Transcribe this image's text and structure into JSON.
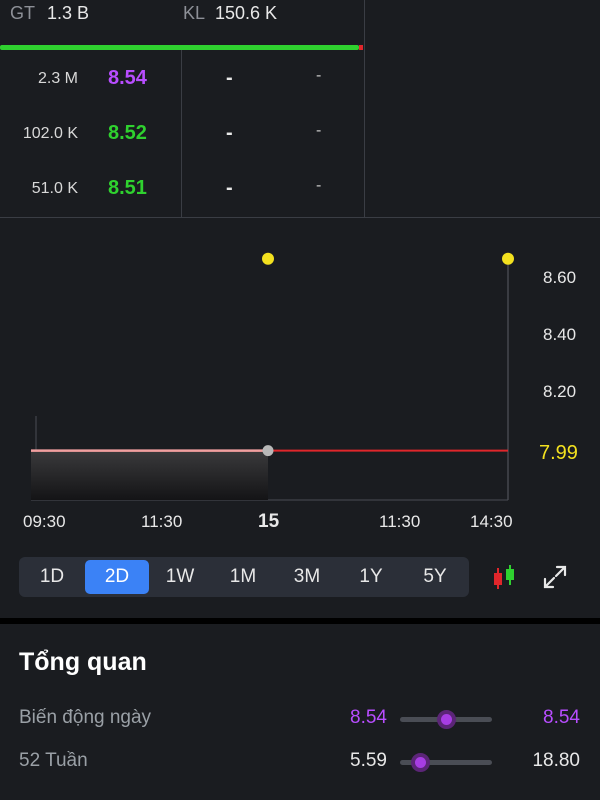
{
  "orderbook": {
    "stats": {
      "gt_label": "GT",
      "gt_value": "1.3 B",
      "kl_label": "KL",
      "kl_value": "150.6 K"
    },
    "bid_rows": [
      {
        "volume": "2.3 M",
        "price": "8.54",
        "price_color": "#b84dff",
        "col3": "-",
        "col4": "-"
      },
      {
        "volume": "102.0 K",
        "price": "8.52",
        "price_color": "#2fd12f",
        "col3": "-",
        "col4": "-"
      },
      {
        "volume": "51.0 K",
        "price": "8.51",
        "price_color": "#2fd12f",
        "col3": "-",
        "col4": "-"
      }
    ],
    "buy_sell_ratio": {
      "buy_fraction": 0.99,
      "buy_color": "#2fd12f",
      "sell_color": "#e0262b"
    }
  },
  "chart": {
    "y_ticks": [
      "8.60",
      "8.40",
      "8.20"
    ],
    "reference_price": "7.99",
    "x_ticks": [
      "09:30",
      "11:30",
      "15",
      "11:30",
      "14:30"
    ]
  },
  "chart_data": {
    "type": "line",
    "y_axis": {
      "min": 7.85,
      "max": 8.65,
      "ticks": [
        8.6,
        8.4,
        8.2
      ]
    },
    "reference_line": {
      "value": 7.99,
      "color": "#e0262b",
      "label_color": "#f3e11f"
    },
    "x_ticks": [
      "09:30",
      "11:30",
      "15",
      "11:30",
      "14:30"
    ],
    "series": [
      {
        "points": [
          {
            "x": "09:30",
            "y": 7.99
          },
          {
            "x": "15",
            "y": 7.99
          }
        ],
        "color": "#f0a0a0"
      }
    ],
    "markers": [
      {
        "x": "15",
        "y": 8.54,
        "color": "#f3e11f"
      },
      {
        "x": "14:30",
        "y": 8.54,
        "color": "#f3e11f"
      }
    ],
    "current_point": {
      "x": "15",
      "y": 7.99
    },
    "grid": false
  },
  "range_selector": {
    "tabs": [
      "1D",
      "2D",
      "1W",
      "1M",
      "3M",
      "1Y",
      "5Y"
    ],
    "active": "2D"
  },
  "tools": {
    "candlestick_icon": "candlestick-icon",
    "expand_icon": "expand-icon"
  },
  "overview": {
    "title": "Tổng quan",
    "rows": [
      {
        "label": "Biến động ngày",
        "low": "8.54",
        "high": "8.54",
        "low_color": "#b84dff",
        "high_color": "#b84dff",
        "position": 0.5
      },
      {
        "label": "52 Tuần",
        "low": "5.59",
        "high": "18.80",
        "low_color": "#e8e8e8",
        "high_color": "#e8e8e8",
        "position": 0.22
      }
    ]
  }
}
